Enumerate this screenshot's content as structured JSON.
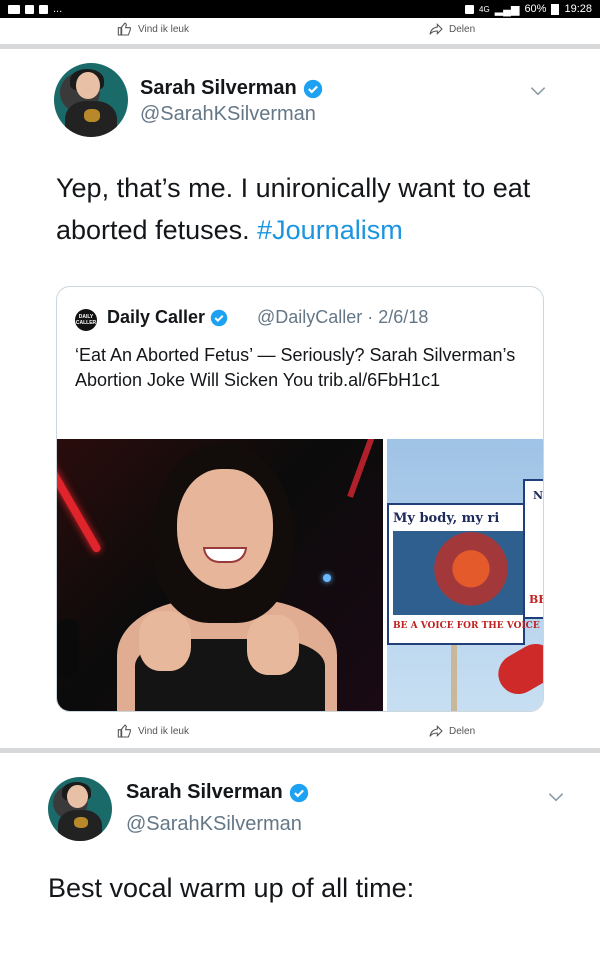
{
  "status_bar": {
    "left_more": "...",
    "signal": "4G",
    "battery": "60%",
    "time": "19:28"
  },
  "fb_actions_top": {
    "like": "Vind ik leuk",
    "share": "Delen"
  },
  "tweet1": {
    "name": "Sarah Silverman",
    "handle": "@SarahKSilverman",
    "text_before": "Yep, that’s me. I unironically want to eat aborted fetuses. ",
    "hashtag": "#Journalism"
  },
  "quote": {
    "logo_text": "DAILY CALLER",
    "name": "Daily Caller",
    "handle_date": "@DailyCaller · 2/6/18",
    "text": "‘Eat An Aborted Fetus’ — Seriously? Sarah Silverman’s Abortion Joke Will Sicken You trib.al/6FbH1c1",
    "sign_title": "My body, my ri",
    "sign_footer": "BE A VOICE FOR THE VOICE",
    "sign2_top": "N",
    "sign2_mid": "BE"
  },
  "fb_actions_bottom": {
    "like": "Vind ik leuk",
    "share": "Delen"
  },
  "tweet2": {
    "name": "Sarah Silverman",
    "handle": "@SarahKSilverman",
    "text": "Best vocal warm up of all time:"
  },
  "colors": {
    "link": "#1b95e0",
    "verified": "#1da1f2",
    "muted": "#657786"
  },
  "icons": [
    "thumbs-up-icon",
    "share-icon",
    "verified-icon",
    "chevron-down-icon"
  ]
}
